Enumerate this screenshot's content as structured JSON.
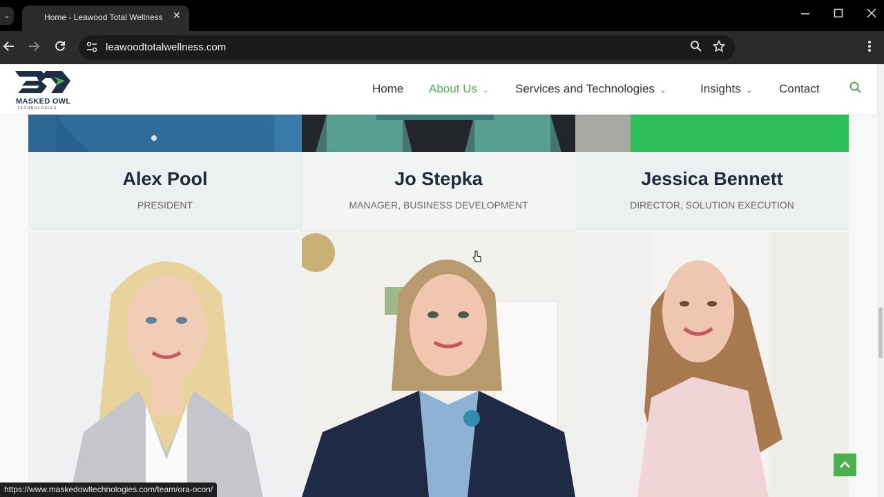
{
  "browser": {
    "tab_title": "Home - Leawood Total Wellness",
    "tab_close": "✕",
    "tab_menu": "⌄",
    "url": "leawoodtotalwellness.com",
    "status_url": "https://www.maskedowltechnologies.com/team/ora-ocon/",
    "icons": [
      "back-arrow-icon",
      "forward-arrow-icon",
      "reload-icon",
      "site-info-icon",
      "zoom-icon",
      "bookmark-star-icon",
      "kebab-menu-icon"
    ]
  },
  "logo": {
    "name": "MASKED OWL",
    "sub": "TECHNOLOGIES"
  },
  "nav": {
    "items": [
      {
        "label": "Home",
        "active": false,
        "dropdown": false
      },
      {
        "label": "About Us",
        "active": true,
        "dropdown": true
      },
      {
        "label": "Services and Technologies",
        "active": false,
        "dropdown": true
      },
      {
        "label": "Insights",
        "active": false,
        "dropdown": true
      },
      {
        "label": "Contact",
        "active": false,
        "dropdown": false
      }
    ],
    "accent_color": "#4caf50"
  },
  "team": [
    {
      "name": "Alex Pool",
      "title": "PRESIDENT"
    },
    {
      "name": "Jo Stepka",
      "title": "MANAGER, BUSINESS DEVELOPMENT"
    },
    {
      "name": "Jessica Bennett",
      "title": "DIRECTOR, SOLUTION EXECUTION"
    }
  ],
  "colors": {
    "heading": "#1c2a3c",
    "panel": "#edf0f1",
    "back_to_top": "#4caf50"
  }
}
